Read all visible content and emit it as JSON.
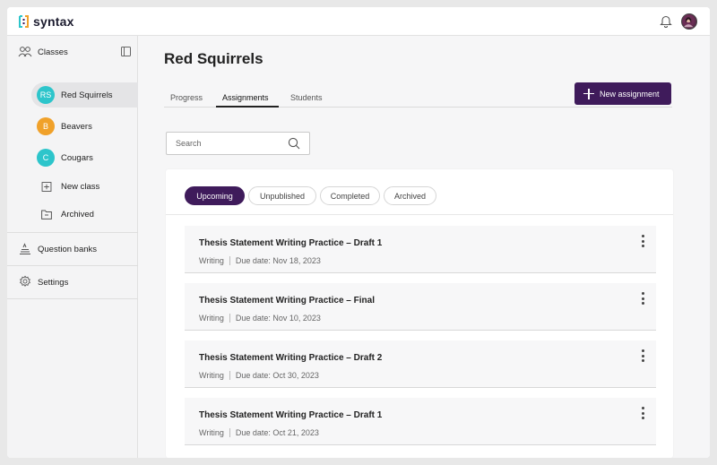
{
  "app": {
    "logo_text": "syntax"
  },
  "sidebar": {
    "classes_label": "Classes",
    "classes": [
      {
        "initials": "RS",
        "name": "Red Squirrels",
        "color": "#2dc5cb",
        "active": true
      },
      {
        "initials": "B",
        "name": "Beavers",
        "color": "#f0a12a",
        "active": false
      },
      {
        "initials": "C",
        "name": "Cougars",
        "color": "#2dc5cb",
        "active": false
      }
    ],
    "new_class_label": "New class",
    "archived_label": "Archived",
    "question_banks_label": "Question banks",
    "settings_label": "Settings"
  },
  "page": {
    "title": "Red Squirrels",
    "tabs": [
      {
        "label": "Progress",
        "active": false
      },
      {
        "label": "Assignments",
        "active": true
      },
      {
        "label": "Students",
        "active": false
      }
    ],
    "new_assignment_label": "New assignment",
    "search_placeholder": "Search"
  },
  "filters": [
    {
      "label": "Upcoming",
      "active": true
    },
    {
      "label": "Unpublished",
      "active": false
    },
    {
      "label": "Completed",
      "active": false
    },
    {
      "label": "Archived",
      "active": false
    }
  ],
  "assignments": [
    {
      "title": "Thesis Statement Writing Practice – Draft 1",
      "category": "Writing",
      "due": "Due date: Nov 18, 2023"
    },
    {
      "title": "Thesis Statement Writing Practice – Final",
      "category": "Writing",
      "due": "Due date: Nov 10, 2023"
    },
    {
      "title": "Thesis Statement Writing Practice – Draft 2",
      "category": "Writing",
      "due": "Due date: Oct 30, 2023"
    },
    {
      "title": "Thesis Statement Writing Practice – Draft 1",
      "category": "Writing",
      "due": "Due date: Oct 21, 2023"
    }
  ],
  "colors": {
    "accent": "#3f1b5b",
    "teal": "#2dc5cb",
    "orange": "#f0a12a"
  }
}
